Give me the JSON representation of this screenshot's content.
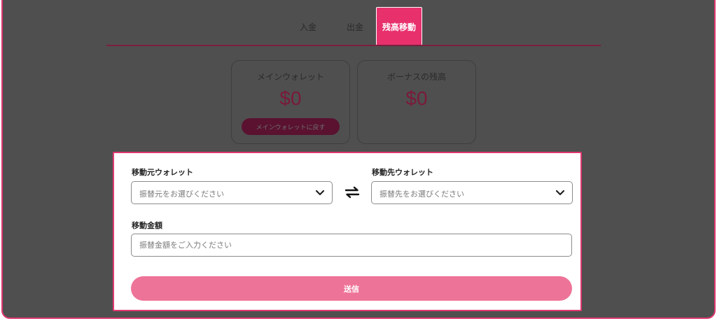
{
  "tabs": [
    {
      "label": "入金"
    },
    {
      "label": "出金"
    },
    {
      "label": "残高移動",
      "active": true
    }
  ],
  "wallets": {
    "main": {
      "title": "メインウォレット",
      "amount": "$0",
      "return_button": "メインウォレットに戻す"
    },
    "bonus": {
      "title": "ボーナスの残高",
      "amount": "$0"
    }
  },
  "form": {
    "from_label": "移動元ウォレット",
    "from_placeholder": "振替元をお選びください",
    "to_label": "移動先ウォレット",
    "to_placeholder": "振替先をお選びください",
    "amount_label": "移動金額",
    "amount_placeholder": "振替金額をご入力ください",
    "submit_label": "送信"
  },
  "colors": {
    "accent": "#e8306d",
    "overlay": "#4f4f4f",
    "submit": "#ee7398",
    "return_button": "#5a1230"
  },
  "icons": {
    "select_chevron": "chevron-down-icon",
    "swap": "swap-arrows-icon"
  }
}
